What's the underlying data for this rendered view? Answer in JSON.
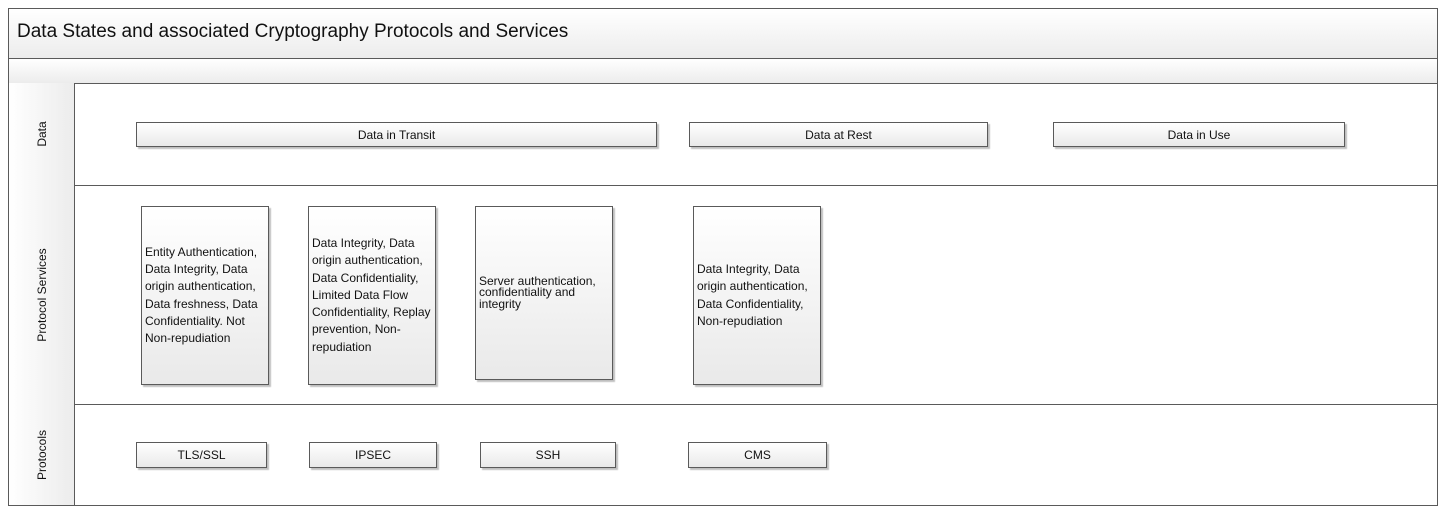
{
  "title": "Data States and associated Cryptography Protocols and Services",
  "lanes": {
    "data": "Data",
    "services": "Protocol Services",
    "protocols": "Protocols"
  },
  "data_states": {
    "transit": "Data in Transit",
    "rest": "Data at Rest",
    "use": "Data in Use"
  },
  "services": {
    "tls": "Entity Authentication, Data Integrity, Data origin authentication, Data freshness, Data Confidentiality. Not Non-repudiation",
    "ipsec": "Data Integrity, Data origin authentication, Data Confidentiality, Limited Data Flow Confidentiality, Replay prevention, Non-repudiation",
    "ssh": "Server authentication, confidentiality and integrity",
    "cms": "Data Integrity, Data origin authentication, Data Confidentiality, Non-repudiation"
  },
  "protocols": {
    "tls": "TLS/SSL",
    "ipsec": "IPSEC",
    "ssh": "SSH",
    "cms": "CMS"
  }
}
